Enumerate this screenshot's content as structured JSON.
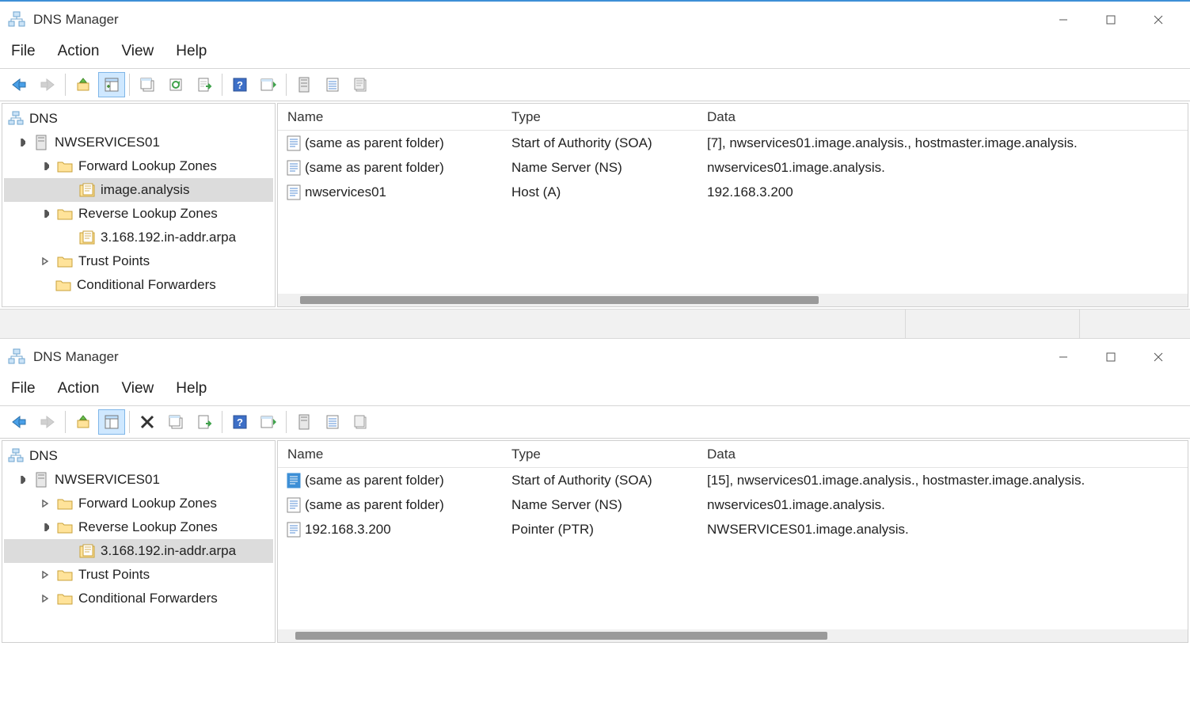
{
  "app_title": "DNS Manager",
  "menus": {
    "file": "File",
    "action": "Action",
    "view": "View",
    "help": "Help"
  },
  "columns": {
    "name": "Name",
    "type": "Type",
    "data": "Data"
  },
  "window1": {
    "tree": {
      "root": "DNS",
      "server": "NWSERVICES01",
      "flz": "Forward Lookup Zones",
      "flz_child": "image.analysis",
      "rlz": "Reverse Lookup Zones",
      "rlz_child": "3.168.192.in-addr.arpa",
      "tp": "Trust Points",
      "cf": "Conditional Forwarders"
    },
    "rows": [
      {
        "name": "(same as parent folder)",
        "type": "Start of Authority (SOA)",
        "data": "[7], nwservices01.image.analysis., hostmaster.image.analysis."
      },
      {
        "name": "(same as parent folder)",
        "type": "Name Server (NS)",
        "data": "nwservices01.image.analysis."
      },
      {
        "name": "nwservices01",
        "type": "Host (A)",
        "data": "192.168.3.200"
      }
    ]
  },
  "window2": {
    "tree": {
      "root": "DNS",
      "server": "NWSERVICES01",
      "flz": "Forward Lookup Zones",
      "rlz": "Reverse Lookup Zones",
      "rlz_child": "3.168.192.in-addr.arpa",
      "tp": "Trust Points",
      "cf": "Conditional Forwarders"
    },
    "rows": [
      {
        "name": "(same as parent folder)",
        "type": "Start of Authority (SOA)",
        "data": "[15], nwservices01.image.analysis., hostmaster.image.analysis."
      },
      {
        "name": "(same as parent folder)",
        "type": "Name Server (NS)",
        "data": "nwservices01.image.analysis."
      },
      {
        "name": "192.168.3.200",
        "type": "Pointer (PTR)",
        "data": "NWSERVICES01.image.analysis."
      }
    ]
  }
}
